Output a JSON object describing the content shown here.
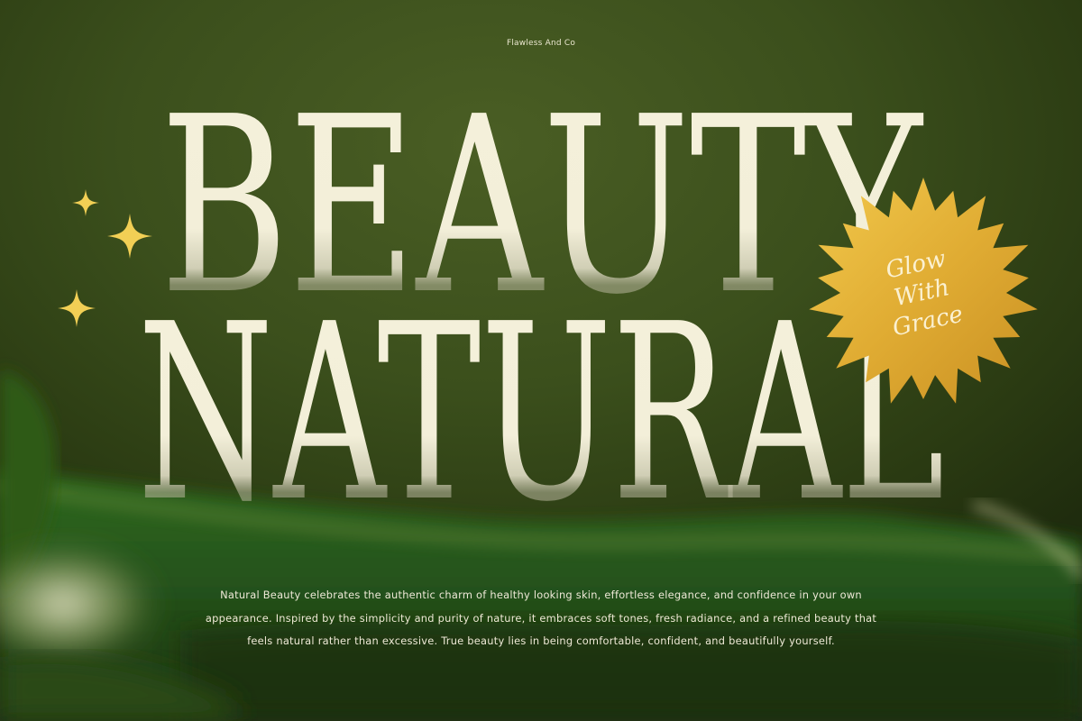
{
  "brand": "Flawless And Co",
  "headline": {
    "line1": "BEAUTY",
    "line2": "NATURAL"
  },
  "badge": {
    "line1": "Glow",
    "line2": "With",
    "line3": "Grace"
  },
  "paragraph": "Natural Beauty celebrates the authentic charm of healthy looking skin, effortless elegance, and confidence in your own appearance. Inspired by the simplicity and purity of nature, it embraces soft tones, fresh radiance, and a refined beauty that feels natural rather than excessive. True beauty lies in being comfortable, confident, and beautifully yourself.",
  "colors": {
    "background": "#3b4f1c",
    "headline_text": "#f3efd9",
    "sparkle": "#f2cf55",
    "badge_gold": "#e3b238"
  },
  "icons": [
    "sparkle-icon",
    "sparkle-icon",
    "sparkle-icon",
    "sunburst-badge-icon"
  ]
}
